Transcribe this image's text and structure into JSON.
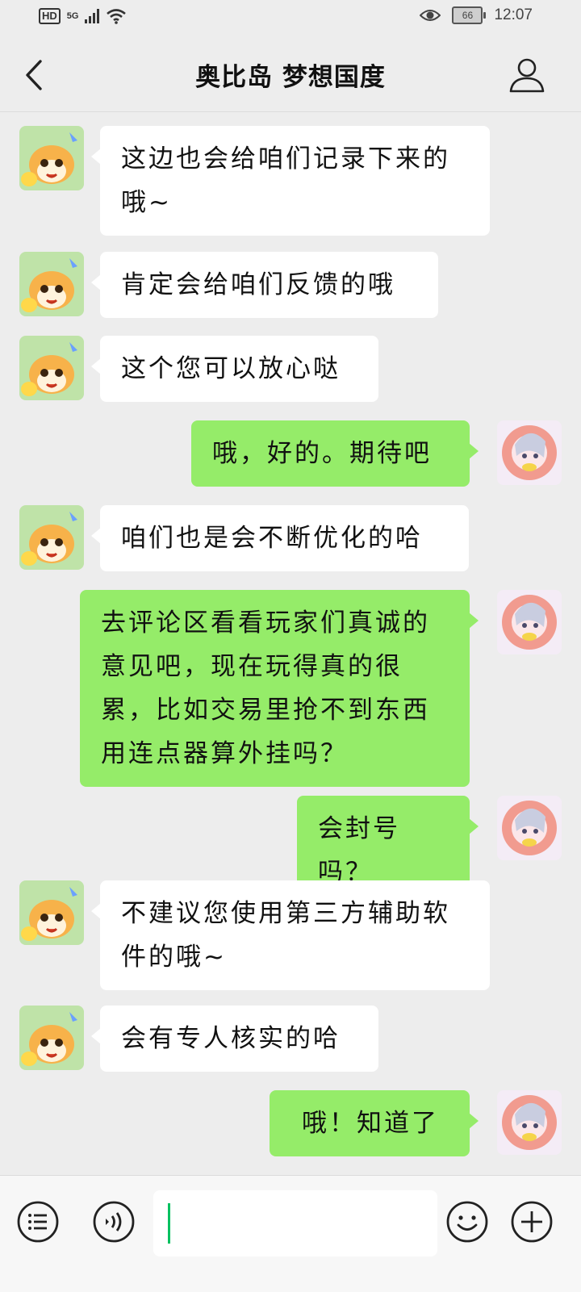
{
  "status_bar": {
    "hd": "HD",
    "network": "5G",
    "battery": "66",
    "time": "12:07"
  },
  "header": {
    "title": "奥比岛 梦想国度"
  },
  "messages": [
    {
      "from": "bot",
      "text": "这边也会给咱们记录下来的哦~"
    },
    {
      "from": "bot",
      "text": "肯定会给咱们反馈的哦"
    },
    {
      "from": "bot",
      "text": "这个您可以放心哒"
    },
    {
      "from": "me",
      "text": "哦，好的。期待吧"
    },
    {
      "from": "bot",
      "text": "咱们也是会不断优化的哈"
    },
    {
      "from": "me",
      "text": "去评论区看看玩家们真诚的意见吧，现在玩得真的很累，比如交易里抢不到东西用连点器算外挂吗？"
    },
    {
      "from": "me",
      "text": "会封号吗？"
    },
    {
      "from": "bot",
      "text": "不建议您使用第三方辅助软件的哦~"
    },
    {
      "from": "bot",
      "text": "会有专人核实的哈"
    },
    {
      "from": "me",
      "text": "哦！知道了"
    }
  ],
  "input": {
    "value": ""
  },
  "icons": {
    "back": "chevron-left-icon",
    "profile": "person-icon",
    "menu": "list-menu-icon",
    "voice": "voice-icon",
    "emoji": "smiley-icon",
    "add": "plus-icon"
  },
  "colors": {
    "background": "#ededed",
    "incoming_bubble": "#ffffff",
    "outgoing_bubble": "#95ec69",
    "caret": "#07c160"
  }
}
